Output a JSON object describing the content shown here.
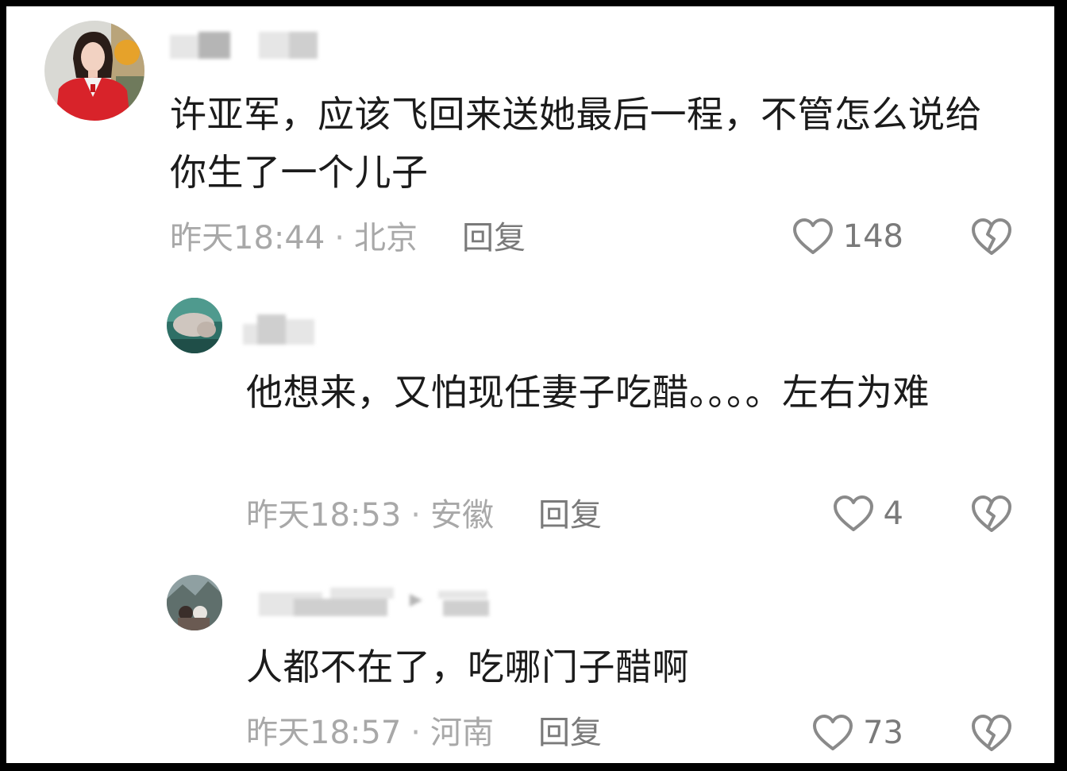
{
  "comments": [
    {
      "username": "",
      "text": "许亚军，应该飞回来送她最后一程，不管怎么说给你生了一个儿子",
      "time": "昨天18:44",
      "location": "北京",
      "reply_label": "回复",
      "likes": "148"
    },
    {
      "username": "",
      "text": "他想来，又怕现任妻子吃醋。。。。左右为难",
      "time": "昨天18:53",
      "location": "安徽",
      "reply_label": "回复",
      "likes": "4"
    },
    {
      "username": "",
      "text": "人都不在了，吃哪门子醋啊",
      "time": "昨天18:57",
      "location": "河南",
      "reply_label": "回复",
      "likes": "73"
    }
  ],
  "separator": "·",
  "icons": {
    "like": "heart-outline-icon",
    "dislike": "broken-heart-icon"
  },
  "colors": {
    "text": "#1b1b1b",
    "meta": "#a8a8a8",
    "reply": "#7a7a7a",
    "icon": "#8a8a8a",
    "border": "#000000"
  }
}
